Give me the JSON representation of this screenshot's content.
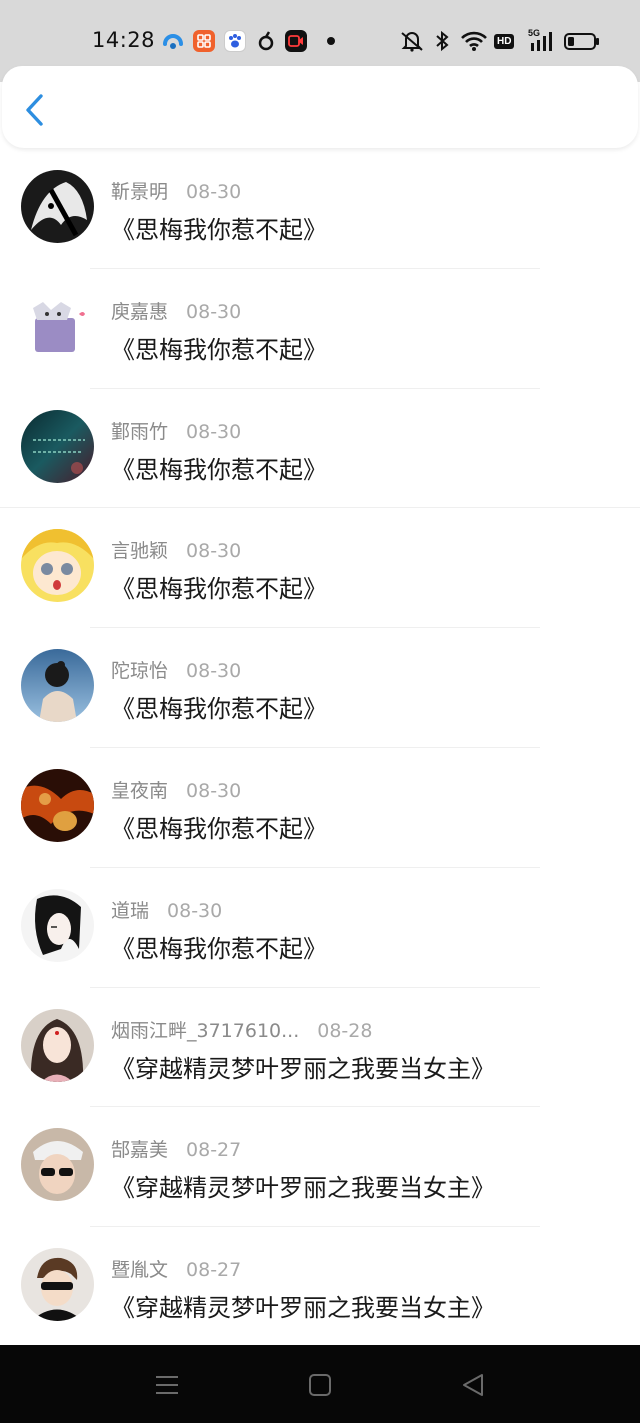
{
  "status_bar": {
    "time": "14:28",
    "icons": [
      "app-icon-1",
      "app-icon-2",
      "baidu-icon",
      "app-icon-4",
      "video-record-icon",
      "notification-dot",
      "mute-icon",
      "bluetooth-icon",
      "wifi-icon",
      "hd-icon",
      "signal-5g-icon",
      "battery-icon"
    ],
    "hd_label": "HD",
    "network_label": "5G"
  },
  "header": {
    "back_icon": "chevron-left-icon",
    "accent_color": "#2d8ee0"
  },
  "comments": [
    {
      "user": "靳景明",
      "date": "08-30",
      "book": "《思梅我你惹不起》"
    },
    {
      "user": "庾嘉惠",
      "date": "08-30",
      "book": "《思梅我你惹不起》"
    },
    {
      "user": "鄞雨竹",
      "date": "08-30",
      "book": "《思梅我你惹不起》"
    },
    {
      "user": "言驰颖",
      "date": "08-30",
      "book": "《思梅我你惹不起》"
    },
    {
      "user": "陀琼怡",
      "date": "08-30",
      "book": "《思梅我你惹不起》"
    },
    {
      "user": "皇夜南",
      "date": "08-30",
      "book": "《思梅我你惹不起》"
    },
    {
      "user": "道瑞",
      "date": "08-30",
      "book": "《思梅我你惹不起》"
    },
    {
      "user": "烟雨江畔_3717610...",
      "date": "08-28",
      "book": "《穿越精灵梦叶罗丽之我要当女主》"
    },
    {
      "user": "郜嘉美",
      "date": "08-27",
      "book": "《穿越精灵梦叶罗丽之我要当女主》"
    },
    {
      "user": "暨胤文",
      "date": "08-27",
      "book": "《穿越精灵梦叶罗丽之我要当女主》"
    }
  ],
  "nav_bar": {
    "icons": [
      "menu-icon",
      "home-icon",
      "back-triangle-icon"
    ]
  }
}
